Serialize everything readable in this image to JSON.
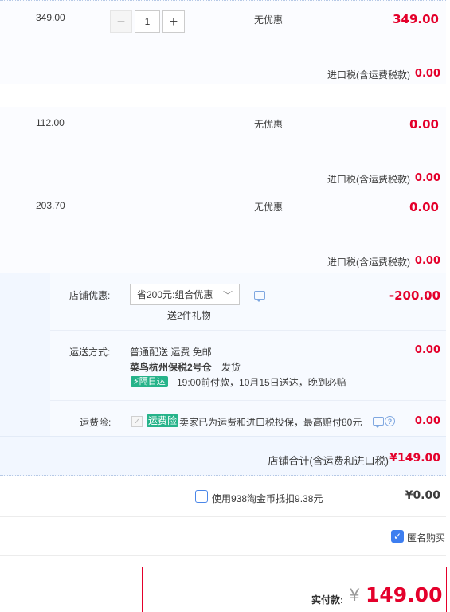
{
  "items": [
    {
      "price": "349.00",
      "quantity": "1",
      "promo": "无优惠",
      "subtotal": "349.00",
      "tax_label": "进口税(含运费税款)",
      "tax_value": "0.00"
    },
    {
      "price": "112.00",
      "promo": "无优惠",
      "subtotal": "0.00",
      "tax_label": "进口税(含运费税款)",
      "tax_value": "0.00"
    },
    {
      "price": "203.70",
      "promo": "无优惠",
      "subtotal": "0.00",
      "tax_label": "进口税(含运费税款)",
      "tax_value": "0.00"
    }
  ],
  "quantity_controls": {
    "minus": "−",
    "plus": "+"
  },
  "shop": {
    "discount_label": "店铺优惠:",
    "discount_selected": "省200元:组合优惠",
    "gift_text": "送2件礼物",
    "discount_value": "-200.00",
    "shipping_label": "运送方式:",
    "shipping_method": "普通配送 运费 免邮",
    "warehouse": "菜鸟杭州保税2号仓",
    "ship_action": "发货",
    "next_day_badge": "隔日达",
    "delivery_promise": "19:00前付款，10月15日送达，晚到必赔",
    "shipping_value": "0.00",
    "insurance_label": "运费险:",
    "insurance_badge": "运费险",
    "insurance_text": "卖家已为运费和进口税投保，最高赔付80元",
    "insurance_value": "0.00",
    "total_label": "店铺合计(含运费和进口税)",
    "total_value": "¥149.00"
  },
  "coins": {
    "label": "使用938淘金币抵扣9.38元",
    "value": "¥0.00"
  },
  "anonymous": {
    "label": "匿名购买",
    "checked": true
  },
  "payment": {
    "label": "实付款:",
    "currency": "¥",
    "amount": "149.00"
  },
  "colors": {
    "accent_red": "#e4002b",
    "panel_blue": "#f2f7ff",
    "checkbox_blue": "#3d7ef0",
    "badge_green": "#26b38a"
  }
}
